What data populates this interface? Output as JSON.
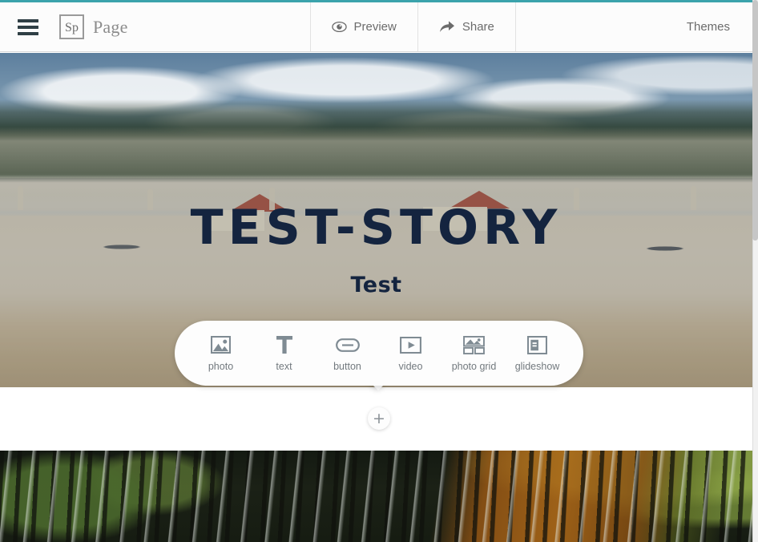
{
  "theme": {
    "accent_top_line": "#3ba3ac",
    "topbar_bg": "#fcfcfc",
    "topbar_text": "#6b6b6b",
    "heading_color": "#14243f",
    "toolbar_bg": "#fdfdfd",
    "caption_color": "#72797e"
  },
  "topbar": {
    "menu_icon": "hamburger-menu-icon",
    "logo_badge": "Sp",
    "app_title": "Page",
    "actions": [
      {
        "label": "Preview",
        "icon": "eye-icon"
      },
      {
        "label": "Share",
        "icon": "share-arrow-icon"
      }
    ],
    "themes_label": "Themes"
  },
  "hero": {
    "heading": "TEST-STORY",
    "subheading": "Test",
    "image_alt": "panoramic-palace-garden-plaza"
  },
  "insert_toolbar": {
    "items": [
      {
        "label": "photo",
        "icon": "photo-icon"
      },
      {
        "label": "text",
        "icon": "text-t-icon"
      },
      {
        "label": "button",
        "icon": "button-pill-icon"
      },
      {
        "label": "video",
        "icon": "video-play-icon"
      },
      {
        "label": "photo grid",
        "icon": "photo-grid-icon"
      },
      {
        "label": "glideshow",
        "icon": "glideshow-icon"
      }
    ],
    "add_block_label": "+"
  },
  "bottom_section": {
    "image_alt": "forest-water-reflection-with-algae"
  }
}
